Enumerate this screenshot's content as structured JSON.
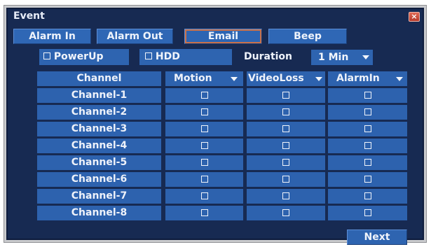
{
  "window": {
    "title": "Event",
    "close_icon": "close-icon"
  },
  "tabs": [
    {
      "label": "Alarm In",
      "active": false
    },
    {
      "label": "Alarm Out",
      "active": false
    },
    {
      "label": "Email",
      "active": true
    },
    {
      "label": "Beep",
      "active": false
    }
  ],
  "options": {
    "powerup_label": "PowerUp",
    "powerup_checked": false,
    "hdd_label": "HDD",
    "hdd_checked": false,
    "duration_label": "Duration",
    "duration_value": "1 Min"
  },
  "table": {
    "columns": [
      "Channel",
      "Motion",
      "VideoLoss",
      "AlarmIn"
    ],
    "rows": [
      {
        "channel": "Channel-1",
        "motion": false,
        "videoloss": false,
        "alarmin": false
      },
      {
        "channel": "Channel-2",
        "motion": false,
        "videoloss": false,
        "alarmin": false
      },
      {
        "channel": "Channel-3",
        "motion": false,
        "videoloss": false,
        "alarmin": false
      },
      {
        "channel": "Channel-4",
        "motion": false,
        "videoloss": false,
        "alarmin": false
      },
      {
        "channel": "Channel-5",
        "motion": false,
        "videoloss": false,
        "alarmin": false
      },
      {
        "channel": "Channel-6",
        "motion": false,
        "videoloss": false,
        "alarmin": false
      },
      {
        "channel": "Channel-7",
        "motion": false,
        "videoloss": false,
        "alarmin": false
      },
      {
        "channel": "Channel-8",
        "motion": false,
        "videoloss": false,
        "alarmin": false
      }
    ]
  },
  "footer": {
    "next_label": "Next"
  },
  "colors": {
    "background": "#172a52",
    "cell": "#2d62ae",
    "accent": "#c9714a",
    "close": "#c94b37"
  }
}
